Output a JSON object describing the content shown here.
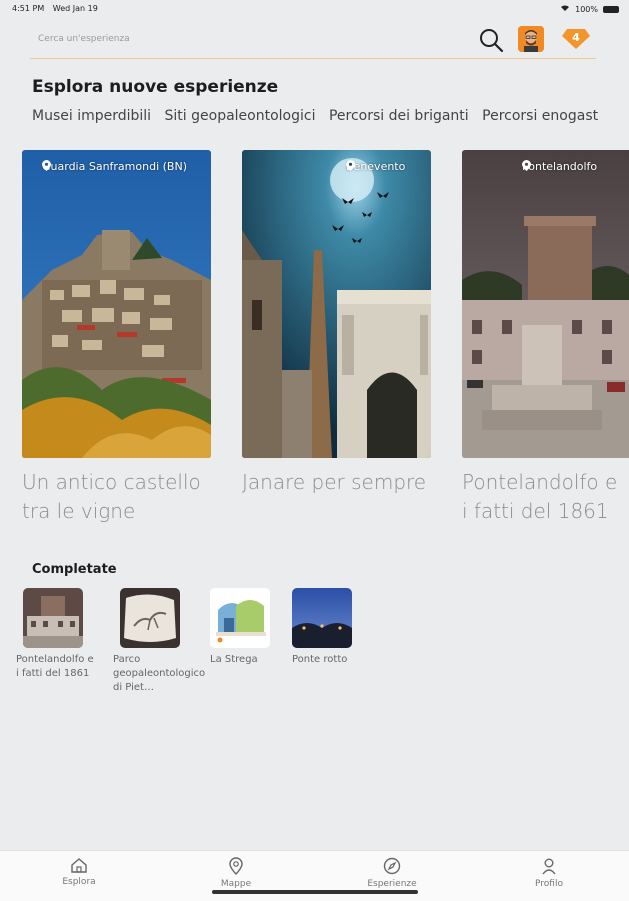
{
  "status": {
    "time": "4:51 PM",
    "date": "Wed Jan 19",
    "battery": "100%"
  },
  "search": {
    "placeholder": "Cerca un'esperienza"
  },
  "header": {
    "gems_count": "4"
  },
  "explore": {
    "title": "Esplora nuove esperienze",
    "categories": [
      "Musei imperdibili",
      "Siti geopaleontologici",
      "Percorsi dei briganti",
      "Percorsi enogastr"
    ]
  },
  "cards": [
    {
      "location": "Guardia Sanframondi (BN)",
      "title": "Un antico castello tra le vigne"
    },
    {
      "location": "Benevento",
      "title": "Janare per sempre"
    },
    {
      "location": "Pontelandolfo",
      "title": "Pontelandolfo e i fatti del 1861"
    }
  ],
  "completed": {
    "title": "Completate",
    "items": [
      {
        "label": "Pontelandolfo e i fatti del 1861"
      },
      {
        "label": "Parco geopaleontologico di Piet…"
      },
      {
        "label": "La Strega"
      },
      {
        "label": "Ponte rotto"
      }
    ]
  },
  "tabs": [
    {
      "label": "Esplora",
      "icon": "home-icon"
    },
    {
      "label": "Mappe",
      "icon": "map-pin-icon"
    },
    {
      "label": "Esperienze",
      "icon": "compass-icon"
    },
    {
      "label": "Profilo",
      "icon": "person-icon"
    }
  ],
  "colors": {
    "accent": "#f08a24",
    "underline": "#f3c891",
    "background": "#ebeced"
  }
}
